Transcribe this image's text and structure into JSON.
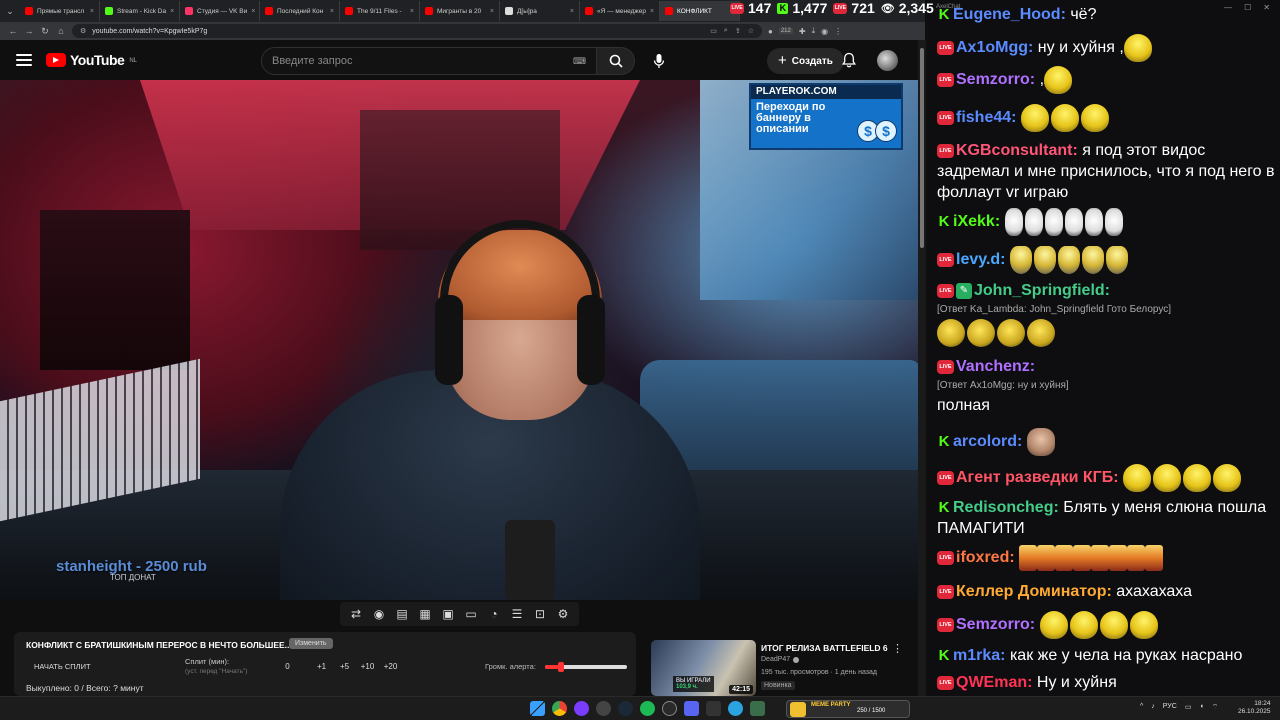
{
  "browser": {
    "tabs": [
      {
        "label": "Прямые трансл",
        "color": "#ff0000"
      },
      {
        "label": "Stream - Kick Da",
        "color": "#53fc18"
      },
      {
        "label": "Студия — VK Ви",
        "color": "#ff3366"
      },
      {
        "label": "Последний Кон",
        "color": "#ff0000"
      },
      {
        "label": "The 9/11 Files -",
        "color": "#ff0000"
      },
      {
        "label": "Мигранты в 20",
        "color": "#ff0000"
      },
      {
        "label": "Д[ы]ра",
        "color": "#dddddd"
      },
      {
        "label": "«Я — менеджер",
        "color": "#ff0000"
      },
      {
        "label": "КОНФЛИКТ",
        "color": "#ff0000"
      }
    ],
    "url": "youtube.com/watch?v=KpgwIe5kP7g",
    "badge_count": "212"
  },
  "youtube": {
    "logo_text": "YouTube",
    "region": "NL",
    "search_placeholder": "Введите запрос",
    "create_label": "Создать"
  },
  "video": {
    "ad_site": "PLAYEROK.COM",
    "ad_text": "Переходи по баннеру в описании",
    "ad_coin": "$",
    "donation_text": "stanheight - 2500 rub",
    "donation_sub": "ТОП ДОНАТ"
  },
  "player_controls": [
    "loop-icon",
    "broadcast-icon",
    "translate-icon",
    "clapper-icon",
    "pip-icon",
    "miniplayer-icon",
    "speed-icon",
    "subtitles-icon",
    "screenshot-icon",
    "settings-icon"
  ],
  "info_panel": {
    "title": "КОНФЛИКТ С БРАТИШКИНЫМ ПЕРЕРОС В НЕЧТО БОЛЬШЕЕ...",
    "edit_label": "Изменить",
    "start_split": "НАЧАТЬ СПЛИТ",
    "split_label": "Сплит (мин):",
    "split_sub": "(уст. перед \"Начать\")",
    "split_buttons": [
      "0",
      "+1",
      "+5",
      "+10",
      "+20"
    ],
    "alert_label": "Громк. алерта:",
    "alert_volume": 0.2,
    "bought": "Выкуплено: 0 / Всего: ? минут"
  },
  "recommended": {
    "title": "ИТОГ РЕЛИЗА BATTLEFIELD 6",
    "channel": "DeadP47",
    "meta": "195 тыс. просмотров · 1 день назад",
    "badge": "Новинка",
    "duration": "42:15",
    "thumb_tag": "ВЫ ИГРАЛИ",
    "thumb_tag_val": "103,9 ч."
  },
  "chat": {
    "window_title": "AxelChat",
    "stats": {
      "youtube": "147",
      "kick": "1,477",
      "vk": "721",
      "total": "2,345"
    },
    "messages": [
      {
        "platform": "kick",
        "nick": "Eugene_Hood:",
        "color": "#5b8cff",
        "text": "чё?",
        "emotes": []
      },
      {
        "platform": "live",
        "nick": "Ax1oMgg:",
        "color": "#5b8cff",
        "text": "ну и хуйня ,",
        "emotes": [
          "yellow"
        ]
      },
      {
        "platform": "live",
        "nick": "Semzorro:",
        "color": "#b070ff",
        "text": ",",
        "emotes": [
          "yellow"
        ]
      },
      {
        "platform": "live",
        "nick": "fishe44:",
        "color": "#5b8cff",
        "text": "",
        "emotes": [
          "yellow",
          "yellow",
          "yellow"
        ]
      },
      {
        "platform": "live",
        "nick": "KGBconsultant:",
        "color": "#ff5577",
        "text": "я под этот видос задремал и мне приснилось, что я под него в фоллаут vr играю",
        "emotes": []
      },
      {
        "platform": "kick",
        "nick": "iXekk:",
        "color": "#53fc18",
        "text": "",
        "emotes": [
          "white",
          "white",
          "white",
          "white",
          "white",
          "white"
        ]
      },
      {
        "platform": "live",
        "nick": "levy.d:",
        "color": "#4aa8ff",
        "text": "",
        "emotes": [
          "gold",
          "gold",
          "gold",
          "gold",
          "gold"
        ]
      },
      {
        "platform": "live",
        "nick": "John_Springfield:",
        "color": "#44cc88",
        "text": "",
        "reply": "[Ответ Ka_Lambda: John_Springfield Гото Белорус]",
        "emotes": [
          "chick",
          "chick",
          "chick",
          "chick"
        ]
      },
      {
        "platform": "live",
        "nick": "Vanchenz:",
        "color": "#b070ff",
        "text": "полная",
        "reply": "[Ответ Ax1oMgg: ну и хуйня]",
        "emotes": []
      },
      {
        "platform": "kick",
        "nick": "arcolord:",
        "color": "#5b8cff",
        "text": "",
        "emotes": [
          "face"
        ]
      },
      {
        "platform": "live",
        "nick": "Агент разведки КГБ:",
        "color": "#ff5566",
        "text": "",
        "emotes": [
          "yellow",
          "yellow",
          "yellow",
          "yellow"
        ]
      },
      {
        "platform": "kick",
        "nick": "Redisoncheg:",
        "color": "#44cc88",
        "text": "Блять у меня слюна пошла ПАМАГИТИ",
        "emotes": []
      },
      {
        "platform": "live",
        "nick": "ifoxred:",
        "color": "#ff7744",
        "text": "",
        "emotes": [
          "cat",
          "cat",
          "cat",
          "cat",
          "cat",
          "cat",
          "cat",
          "cat"
        ]
      },
      {
        "platform": "live",
        "nick": "Келлер Доминатор:",
        "color": "#ffaa33",
        "text": "ахахахаха",
        "emotes": []
      },
      {
        "platform": "live",
        "nick": "Semzorro:",
        "color": "#b070ff",
        "text": "",
        "emotes": [
          "yellow",
          "yellow",
          "yellow",
          "yellow"
        ]
      },
      {
        "platform": "kick",
        "nick": "m1rka:",
        "color": "#5b8cff",
        "text": "как же у чела на руках насрано",
        "emotes": []
      },
      {
        "platform": "live",
        "nick": "QWEman:",
        "color": "#ff3355",
        "text": "Ну и хуйня",
        "emotes": []
      }
    ]
  },
  "taskbar": {
    "meme_label": "MEME PARTY",
    "meme_value": "250 / 1500",
    "lang": "РУС",
    "time": "18:24",
    "date": "26.10.2025"
  }
}
